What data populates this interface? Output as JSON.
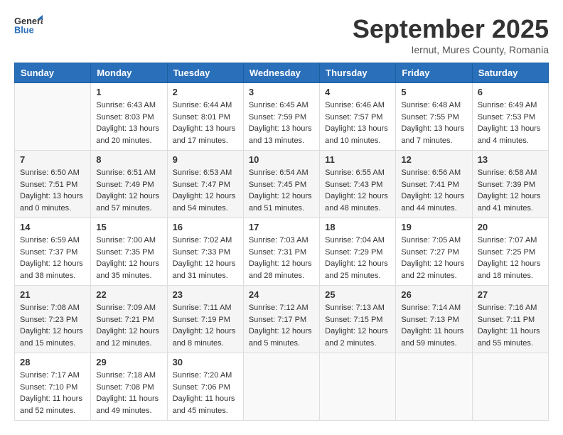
{
  "logo": {
    "general": "General",
    "blue": "Blue"
  },
  "header": {
    "month": "September 2025",
    "location": "Iernut, Mures County, Romania"
  },
  "weekdays": [
    "Sunday",
    "Monday",
    "Tuesday",
    "Wednesday",
    "Thursday",
    "Friday",
    "Saturday"
  ],
  "weeks": [
    [
      {
        "day": "",
        "sunrise": "",
        "sunset": "",
        "daylight": ""
      },
      {
        "day": "1",
        "sunrise": "Sunrise: 6:43 AM",
        "sunset": "Sunset: 8:03 PM",
        "daylight": "Daylight: 13 hours and 20 minutes."
      },
      {
        "day": "2",
        "sunrise": "Sunrise: 6:44 AM",
        "sunset": "Sunset: 8:01 PM",
        "daylight": "Daylight: 13 hours and 17 minutes."
      },
      {
        "day": "3",
        "sunrise": "Sunrise: 6:45 AM",
        "sunset": "Sunset: 7:59 PM",
        "daylight": "Daylight: 13 hours and 13 minutes."
      },
      {
        "day": "4",
        "sunrise": "Sunrise: 6:46 AM",
        "sunset": "Sunset: 7:57 PM",
        "daylight": "Daylight: 13 hours and 10 minutes."
      },
      {
        "day": "5",
        "sunrise": "Sunrise: 6:48 AM",
        "sunset": "Sunset: 7:55 PM",
        "daylight": "Daylight: 13 hours and 7 minutes."
      },
      {
        "day": "6",
        "sunrise": "Sunrise: 6:49 AM",
        "sunset": "Sunset: 7:53 PM",
        "daylight": "Daylight: 13 hours and 4 minutes."
      }
    ],
    [
      {
        "day": "7",
        "sunrise": "Sunrise: 6:50 AM",
        "sunset": "Sunset: 7:51 PM",
        "daylight": "Daylight: 13 hours and 0 minutes."
      },
      {
        "day": "8",
        "sunrise": "Sunrise: 6:51 AM",
        "sunset": "Sunset: 7:49 PM",
        "daylight": "Daylight: 12 hours and 57 minutes."
      },
      {
        "day": "9",
        "sunrise": "Sunrise: 6:53 AM",
        "sunset": "Sunset: 7:47 PM",
        "daylight": "Daylight: 12 hours and 54 minutes."
      },
      {
        "day": "10",
        "sunrise": "Sunrise: 6:54 AM",
        "sunset": "Sunset: 7:45 PM",
        "daylight": "Daylight: 12 hours and 51 minutes."
      },
      {
        "day": "11",
        "sunrise": "Sunrise: 6:55 AM",
        "sunset": "Sunset: 7:43 PM",
        "daylight": "Daylight: 12 hours and 48 minutes."
      },
      {
        "day": "12",
        "sunrise": "Sunrise: 6:56 AM",
        "sunset": "Sunset: 7:41 PM",
        "daylight": "Daylight: 12 hours and 44 minutes."
      },
      {
        "day": "13",
        "sunrise": "Sunrise: 6:58 AM",
        "sunset": "Sunset: 7:39 PM",
        "daylight": "Daylight: 12 hours and 41 minutes."
      }
    ],
    [
      {
        "day": "14",
        "sunrise": "Sunrise: 6:59 AM",
        "sunset": "Sunset: 7:37 PM",
        "daylight": "Daylight: 12 hours and 38 minutes."
      },
      {
        "day": "15",
        "sunrise": "Sunrise: 7:00 AM",
        "sunset": "Sunset: 7:35 PM",
        "daylight": "Daylight: 12 hours and 35 minutes."
      },
      {
        "day": "16",
        "sunrise": "Sunrise: 7:02 AM",
        "sunset": "Sunset: 7:33 PM",
        "daylight": "Daylight: 12 hours and 31 minutes."
      },
      {
        "day": "17",
        "sunrise": "Sunrise: 7:03 AM",
        "sunset": "Sunset: 7:31 PM",
        "daylight": "Daylight: 12 hours and 28 minutes."
      },
      {
        "day": "18",
        "sunrise": "Sunrise: 7:04 AM",
        "sunset": "Sunset: 7:29 PM",
        "daylight": "Daylight: 12 hours and 25 minutes."
      },
      {
        "day": "19",
        "sunrise": "Sunrise: 7:05 AM",
        "sunset": "Sunset: 7:27 PM",
        "daylight": "Daylight: 12 hours and 22 minutes."
      },
      {
        "day": "20",
        "sunrise": "Sunrise: 7:07 AM",
        "sunset": "Sunset: 7:25 PM",
        "daylight": "Daylight: 12 hours and 18 minutes."
      }
    ],
    [
      {
        "day": "21",
        "sunrise": "Sunrise: 7:08 AM",
        "sunset": "Sunset: 7:23 PM",
        "daylight": "Daylight: 12 hours and 15 minutes."
      },
      {
        "day": "22",
        "sunrise": "Sunrise: 7:09 AM",
        "sunset": "Sunset: 7:21 PM",
        "daylight": "Daylight: 12 hours and 12 minutes."
      },
      {
        "day": "23",
        "sunrise": "Sunrise: 7:11 AM",
        "sunset": "Sunset: 7:19 PM",
        "daylight": "Daylight: 12 hours and 8 minutes."
      },
      {
        "day": "24",
        "sunrise": "Sunrise: 7:12 AM",
        "sunset": "Sunset: 7:17 PM",
        "daylight": "Daylight: 12 hours and 5 minutes."
      },
      {
        "day": "25",
        "sunrise": "Sunrise: 7:13 AM",
        "sunset": "Sunset: 7:15 PM",
        "daylight": "Daylight: 12 hours and 2 minutes."
      },
      {
        "day": "26",
        "sunrise": "Sunrise: 7:14 AM",
        "sunset": "Sunset: 7:13 PM",
        "daylight": "Daylight: 11 hours and 59 minutes."
      },
      {
        "day": "27",
        "sunrise": "Sunrise: 7:16 AM",
        "sunset": "Sunset: 7:11 PM",
        "daylight": "Daylight: 11 hours and 55 minutes."
      }
    ],
    [
      {
        "day": "28",
        "sunrise": "Sunrise: 7:17 AM",
        "sunset": "Sunset: 7:10 PM",
        "daylight": "Daylight: 11 hours and 52 minutes."
      },
      {
        "day": "29",
        "sunrise": "Sunrise: 7:18 AM",
        "sunset": "Sunset: 7:08 PM",
        "daylight": "Daylight: 11 hours and 49 minutes."
      },
      {
        "day": "30",
        "sunrise": "Sunrise: 7:20 AM",
        "sunset": "Sunset: 7:06 PM",
        "daylight": "Daylight: 11 hours and 45 minutes."
      },
      {
        "day": "",
        "sunrise": "",
        "sunset": "",
        "daylight": ""
      },
      {
        "day": "",
        "sunrise": "",
        "sunset": "",
        "daylight": ""
      },
      {
        "day": "",
        "sunrise": "",
        "sunset": "",
        "daylight": ""
      },
      {
        "day": "",
        "sunrise": "",
        "sunset": "",
        "daylight": ""
      }
    ]
  ]
}
